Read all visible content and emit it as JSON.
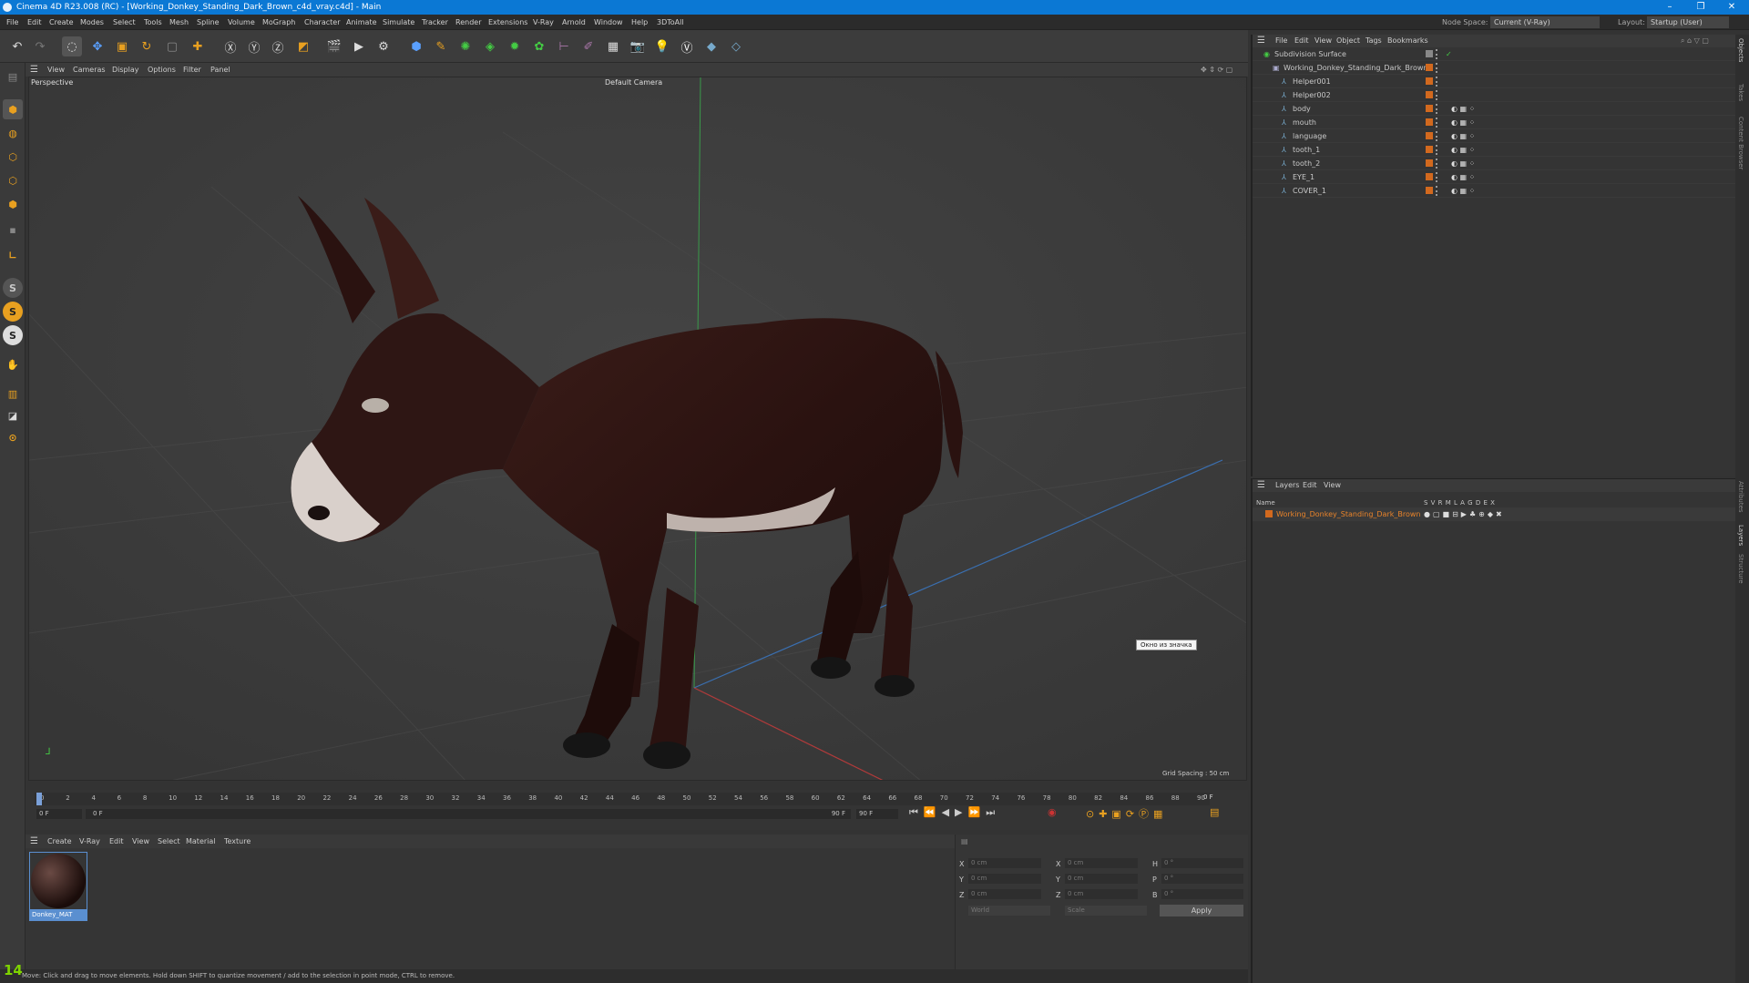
{
  "window": {
    "title": "Cinema 4D R23.008 (RC) - [Working_Donkey_Standing_Dark_Brown_c4d_vray.c4d] - Main",
    "node_space_label": "Node Space:",
    "node_space_value": "Current (V-Ray)",
    "layout_label": "Layout:",
    "layout_value": "Startup (User)"
  },
  "menu": [
    "File",
    "Edit",
    "Create",
    "Modes",
    "Select",
    "Tools",
    "Mesh",
    "Spline",
    "Volume",
    "MoGraph",
    "Character",
    "Animate",
    "Simulate",
    "Tracker",
    "Render",
    "Extensions",
    "V-Ray",
    "Arnold",
    "Window",
    "Help",
    "3DToAll"
  ],
  "viewport": {
    "menu": [
      "View",
      "Cameras",
      "Display",
      "Options",
      "Filter",
      "Panel"
    ],
    "projection": "Perspective",
    "camera": "Default Camera",
    "grid_spacing": "Grid Spacing : 50 cm",
    "tooltip": "Окно из значка"
  },
  "timeline": {
    "ticks": [
      "0",
      "2",
      "4",
      "6",
      "8",
      "10",
      "12",
      "14",
      "16",
      "18",
      "20",
      "22",
      "24",
      "26",
      "28",
      "30",
      "32",
      "34",
      "36",
      "38",
      "40",
      "42",
      "44",
      "46",
      "48",
      "50",
      "52",
      "54",
      "56",
      "58",
      "60",
      "62",
      "64",
      "66",
      "68",
      "70",
      "72",
      "74",
      "76",
      "78",
      "80",
      "82",
      "84",
      "86",
      "88",
      "90"
    ],
    "current_frame": "0 F",
    "start_frame": "0 F",
    "range_start": "0 F",
    "range_end": "90 F",
    "end_frame": "90 F"
  },
  "material": {
    "menu": [
      "Create",
      "V-Ray",
      "Edit",
      "View",
      "Select",
      "Material",
      "Texture"
    ],
    "name": "Donkey_MAT"
  },
  "attributes": {
    "x": "X",
    "y": "Y",
    "z": "Z",
    "h": "H",
    "p": "P",
    "b": "B",
    "pos_value": "0 cm",
    "angle_value": "0 °",
    "coord_mode": "World",
    "scale_mode": "Scale",
    "apply_label": "Apply"
  },
  "objects": {
    "menu": [
      "File",
      "Edit",
      "View",
      "Object",
      "Tags",
      "Bookmarks"
    ],
    "items": [
      {
        "name": "Subdivision Surface",
        "level": 0
      },
      {
        "name": "Working_Donkey_Standing_Dark_Brown",
        "level": 1
      },
      {
        "name": "Helper001",
        "level": 2
      },
      {
        "name": "Helper002",
        "level": 2
      },
      {
        "name": "body",
        "level": 2
      },
      {
        "name": "mouth",
        "level": 2
      },
      {
        "name": "language",
        "level": 2
      },
      {
        "name": "tooth_1",
        "level": 2
      },
      {
        "name": "tooth_2",
        "level": 2
      },
      {
        "name": "EYE_1",
        "level": 2
      },
      {
        "name": "COVER_1",
        "level": 2
      }
    ]
  },
  "layers": {
    "menu": [
      "Layers",
      "Edit",
      "View"
    ],
    "name_col": "Name",
    "cols": "S V R M L A G D E X",
    "item": "Working_Donkey_Standing_Dark_Brown"
  },
  "right_tabs": [
    "Objects",
    "Takes",
    "Content Browser",
    "Attributes",
    "Layers",
    "Structure"
  ],
  "status": {
    "frame_badge": "14",
    "text": "Move: Click and drag to move elements. Hold down SHIFT to quantize movement / add to the selection in point mode, CTRL to remove."
  },
  "colors": {
    "accent": "#0b78d4",
    "layer_orange": "#d2691e",
    "green_badge": "#7fd400"
  }
}
